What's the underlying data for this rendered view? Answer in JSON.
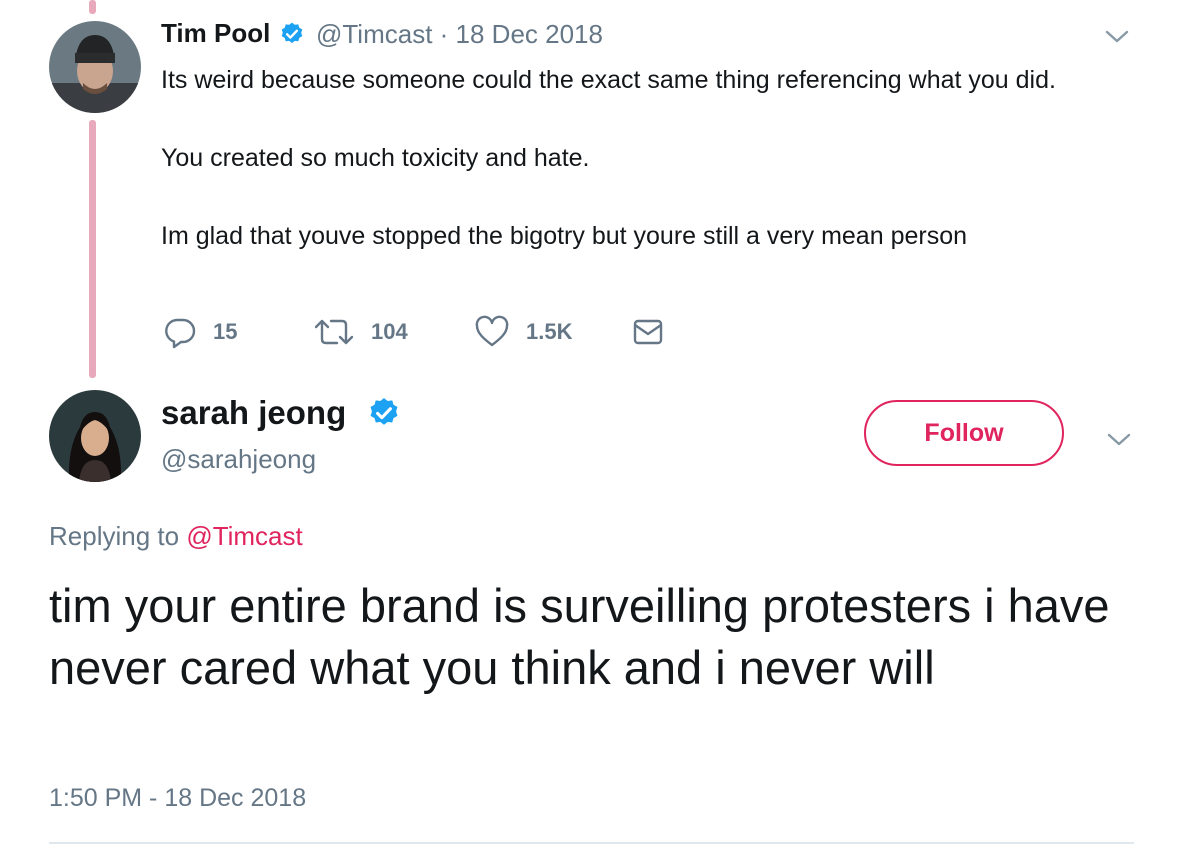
{
  "thread_color": "#e8a9bb",
  "accent_color": "#e0245e",
  "verified_color": "#1da1f2",
  "reply_tweet": {
    "author_name": "Tim Pool",
    "handle_date": "@Timcast · 18 Dec 2018",
    "avatar": "tim-pool-avatar",
    "body_lines": [
      "Its weird because someone could the exact same thing referencing what you did.",
      "You created so much toxicity and hate.",
      "Im glad that youve stopped the bigotry but youre still a very mean person"
    ],
    "actions": {
      "replies": "15",
      "retweets": "104",
      "likes": "1.5K"
    },
    "icons": [
      "reply-icon",
      "retweet-icon",
      "like-icon",
      "direct-message-icon",
      "chevron-down-icon"
    ]
  },
  "main_tweet": {
    "author_name": "sarah jeong",
    "handle": "@sarahjeong",
    "avatar": "sarah-jeong-avatar",
    "follow_label": "Follow",
    "replying_prefix": "Replying to",
    "replying_to": "@Timcast",
    "text": "tim your entire brand is surveilling protesters i have never cared what you think and i never will",
    "timestamp": "1:50 PM - 18 Dec 2018"
  }
}
